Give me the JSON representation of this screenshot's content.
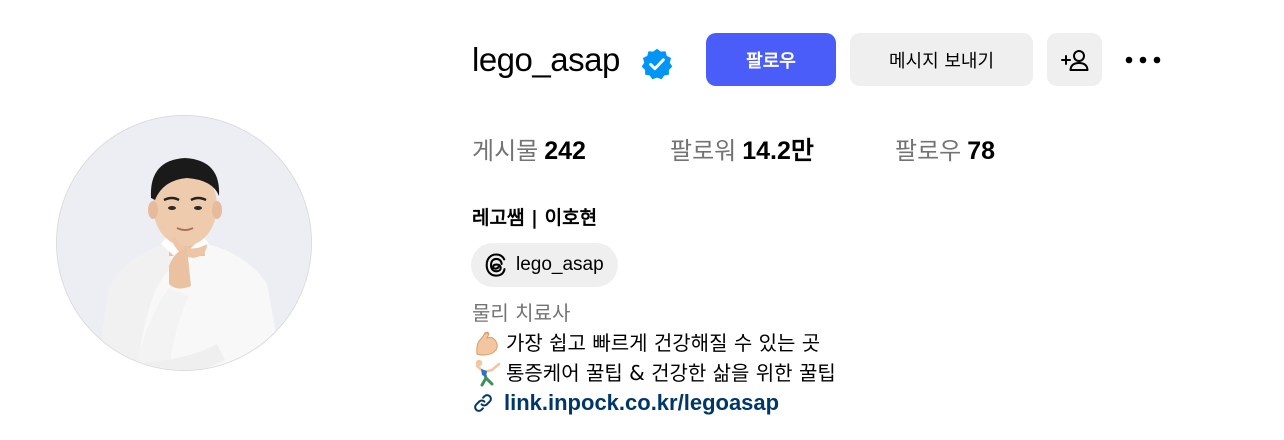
{
  "profile": {
    "username": "lego_asap",
    "verified": true,
    "full_name": "레고쌤 | 이호현",
    "avatar_icon": "profile-photo"
  },
  "actions": {
    "follow_label": "팔로우",
    "message_label": "메시지 보내기",
    "add_user_icon": "add-user-icon",
    "more_icon": "more-options-icon"
  },
  "stats": [
    {
      "label": "게시물",
      "value": "242"
    },
    {
      "label": "팔로워",
      "value": "14.2만"
    },
    {
      "label": "팔로우",
      "value": "78"
    }
  ],
  "threads": {
    "icon": "threads-icon",
    "handle": "lego_asap"
  },
  "bio": {
    "category": "물리 치료사",
    "line1": "가장 쉽고 빠르게 건강해질 수 있는 곳",
    "line1_emoji": "flexed-biceps-emoji",
    "line2": "통증케어 꿀팁 & 건강한 삶을 위한 꿀팁",
    "line2_emoji": "cartwheel-emoji",
    "link": "link.inpock.co.kr/legoasap",
    "link_icon": "link-icon"
  },
  "colors": {
    "accent": "#4a5df9",
    "secondary_button": "#efefef",
    "muted_text": "#737373",
    "link_text": "#00376b",
    "verified_badge": "#0095f6"
  }
}
